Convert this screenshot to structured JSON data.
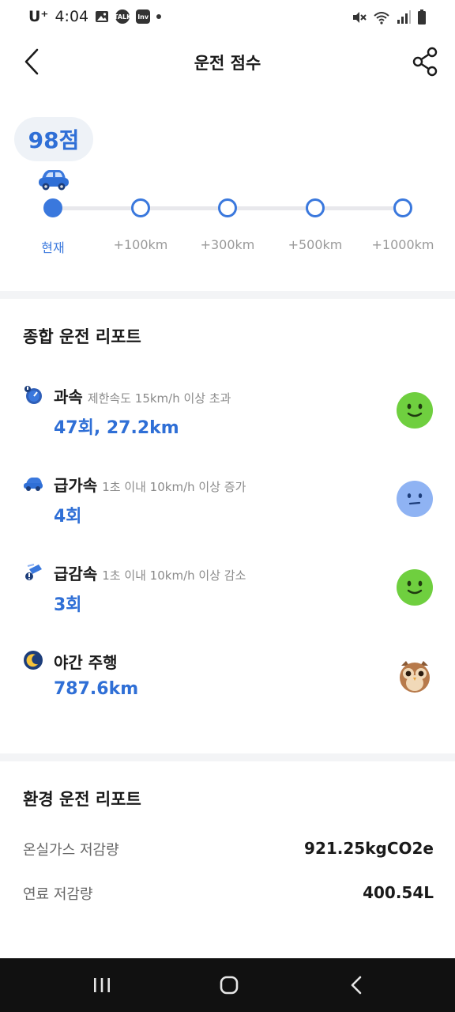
{
  "status_bar": {
    "carrier": "U⁺",
    "time": "4:04",
    "icons": [
      "image-icon",
      "kakaotalk-icon",
      "inv-icon",
      "dot-icon",
      "mute-icon",
      "wifi-icon",
      "signal-icon",
      "battery-icon"
    ],
    "talk_label": "TALK",
    "inv_label": "Inv"
  },
  "header": {
    "title": "운전 점수",
    "back_icon": "chevron-left-icon",
    "share_icon": "share-icon"
  },
  "score": {
    "value": "98점",
    "milestones": [
      {
        "label": "현재",
        "current": true
      },
      {
        "label": "+100km",
        "current": false
      },
      {
        "label": "+300km",
        "current": false
      },
      {
        "label": "+500km",
        "current": false
      },
      {
        "label": "+1000km",
        "current": false
      }
    ]
  },
  "driving_report": {
    "title": "종합 운전 리포트",
    "items": [
      {
        "name": "과속",
        "desc": "제한속도 15km/h 이상 초과",
        "value": "47회, 27.2km",
        "icon": "speedometer-icon",
        "face": "happy-face-green",
        "face_color": "#6fcf3f"
      },
      {
        "name": "급가속",
        "desc": "1초 이내 10km/h 이상 증가",
        "value": "4회",
        "icon": "car-accelerate-icon",
        "face": "neutral-face-blue",
        "face_color": "#8fb3f3"
      },
      {
        "name": "급감속",
        "desc": "1초 이내 10km/h 이상 감소",
        "value": "3회",
        "icon": "car-brake-icon",
        "face": "happy-face-green",
        "face_color": "#6fcf3f"
      },
      {
        "name": "야간 주행",
        "desc": "",
        "value": "787.6km",
        "icon": "moon-icon",
        "face": "owl-icon",
        "face_color": "#c98a5a"
      }
    ]
  },
  "eco_report": {
    "title": "환경 운전 리포트",
    "rows": [
      {
        "label": "온실가스 저감량",
        "value": "921.25kgCO2e"
      },
      {
        "label": "연료 저감량",
        "value": "400.54L"
      }
    ]
  },
  "colors": {
    "accent": "#2f6fd6",
    "track": "#e8e8ec",
    "divider": "#f3f4f6",
    "nav_bar": "#111111"
  }
}
